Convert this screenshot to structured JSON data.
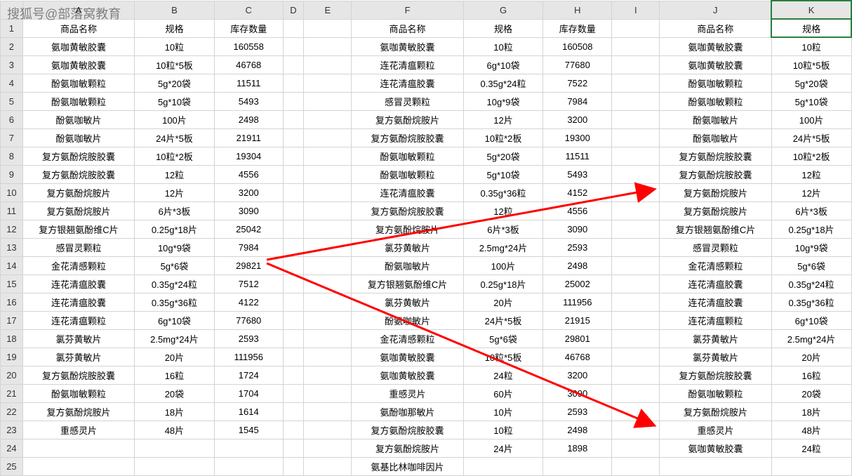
{
  "watermark": "搜狐号@部落窝教育",
  "colLetters": [
    "A",
    "B",
    "C",
    "D",
    "E",
    "F",
    "G",
    "H",
    "I",
    "J",
    "K"
  ],
  "rowNums": [
    "1",
    "2",
    "3",
    "4",
    "5",
    "6",
    "7",
    "8",
    "9",
    "10",
    "11",
    "12",
    "13",
    "14",
    "15",
    "16",
    "17",
    "18",
    "19",
    "20",
    "21",
    "22",
    "23",
    "24",
    "25"
  ],
  "headers": [
    "商品名称",
    "规格",
    "库存数量"
  ],
  "headers2": [
    "商品名称",
    "规格"
  ],
  "table1": [
    {
      "n": "氨咖黄敏胶囊",
      "s": "10粒",
      "q": "160558"
    },
    {
      "n": "氨咖黄敏胶囊",
      "s": "10粒*5板",
      "q": "46768"
    },
    {
      "n": "酚氨咖敏颗粒",
      "s": "5g*20袋",
      "q": "11511"
    },
    {
      "n": "酚氨咖敏颗粒",
      "s": "5g*10袋",
      "q": "5493"
    },
    {
      "n": "酚氨咖敏片",
      "s": "100片",
      "q": "2498"
    },
    {
      "n": "酚氨咖敏片",
      "s": "24片*5板",
      "q": "21911"
    },
    {
      "n": "复方氨酚烷胺胶囊",
      "s": "10粒*2板",
      "q": "19304"
    },
    {
      "n": "复方氨酚烷胺胶囊",
      "s": "12粒",
      "q": "4556"
    },
    {
      "n": "复方氨酚烷胺片",
      "s": "12片",
      "q": "3200"
    },
    {
      "n": "复方氨酚烷胺片",
      "s": "6片*3板",
      "q": "3090"
    },
    {
      "n": "复方银翘氨酚维C片",
      "s": "0.25g*18片",
      "q": "25042"
    },
    {
      "n": "感冒灵颗粒",
      "s": "10g*9袋",
      "q": "7984"
    },
    {
      "n": "金花清感颗粒",
      "s": "5g*6袋",
      "q": "29821"
    },
    {
      "n": "连花清瘟胶囊",
      "s": "0.35g*24粒",
      "q": "7512"
    },
    {
      "n": "连花清瘟胶囊",
      "s": "0.35g*36粒",
      "q": "4122"
    },
    {
      "n": "连花清瘟颗粒",
      "s": "6g*10袋",
      "q": "77680"
    },
    {
      "n": "氯芬黄敏片",
      "s": "2.5mg*24片",
      "q": "2593"
    },
    {
      "n": "氯芬黄敏片",
      "s": "20片",
      "q": "111956"
    },
    {
      "n": "复方氨酚烷胺胶囊",
      "s": "16粒",
      "q": "1724"
    },
    {
      "n": "酚氨咖敏颗粒",
      "s": "20袋",
      "q": "1704"
    },
    {
      "n": "复方氨酚烷胺片",
      "s": "18片",
      "q": "1614"
    },
    {
      "n": "重感灵片",
      "s": "48片",
      "q": "1545"
    },
    {
      "n": "",
      "s": "",
      "q": ""
    },
    {
      "n": "",
      "s": "",
      "q": ""
    }
  ],
  "table2": [
    {
      "n": "氨咖黄敏胶囊",
      "s": "10粒",
      "q": "160508"
    },
    {
      "n": "连花清瘟颗粒",
      "s": "6g*10袋",
      "q": "77680"
    },
    {
      "n": "连花清瘟胶囊",
      "s": "0.35g*24粒",
      "q": "7522"
    },
    {
      "n": "感冒灵颗粒",
      "s": "10g*9袋",
      "q": "7984"
    },
    {
      "n": "复方氨酚烷胺片",
      "s": "12片",
      "q": "3200"
    },
    {
      "n": "复方氨酚烷胺胶囊",
      "s": "10粒*2板",
      "q": "19300"
    },
    {
      "n": "酚氨咖敏颗粒",
      "s": "5g*20袋",
      "q": "11511"
    },
    {
      "n": "酚氨咖敏颗粒",
      "s": "5g*10袋",
      "q": "5493"
    },
    {
      "n": "连花清瘟胶囊",
      "s": "0.35g*36粒",
      "q": "4152"
    },
    {
      "n": "复方氨酚烷胺胶囊",
      "s": "12粒",
      "q": "4556"
    },
    {
      "n": "复方氨酚烷胺片",
      "s": "6片*3板",
      "q": "3090"
    },
    {
      "n": "氯芬黄敏片",
      "s": "2.5mg*24片",
      "q": "2593"
    },
    {
      "n": "酚氨咖敏片",
      "s": "100片",
      "q": "2498"
    },
    {
      "n": "复方银翘氨酚维C片",
      "s": "0.25g*18片",
      "q": "25002"
    },
    {
      "n": "氯芬黄敏片",
      "s": "20片",
      "q": "111956"
    },
    {
      "n": "酚氨咖敏片",
      "s": "24片*5板",
      "q": "21915"
    },
    {
      "n": "金花清感颗粒",
      "s": "5g*6袋",
      "q": "29801"
    },
    {
      "n": "氨咖黄敏胶囊",
      "s": "10粒*5板",
      "q": "46768"
    },
    {
      "n": "氨咖黄敏胶囊",
      "s": "24粒",
      "q": "3200"
    },
    {
      "n": "重感灵片",
      "s": "60片",
      "q": "3090"
    },
    {
      "n": "氨酚咖那敏片",
      "s": "10片",
      "q": "2593"
    },
    {
      "n": "复方氨酚烷胺胶囊",
      "s": "10粒",
      "q": "2498"
    },
    {
      "n": "复方氨酚烷胺片",
      "s": "24片",
      "q": "1898"
    },
    {
      "n": "氨基比林咖啡因片",
      "s": "",
      "q": ""
    }
  ],
  "table3": [
    {
      "n": "氨咖黄敏胶囊",
      "s": "10粒"
    },
    {
      "n": "氨咖黄敏胶囊",
      "s": "10粒*5板"
    },
    {
      "n": "酚氨咖敏颗粒",
      "s": "5g*20袋"
    },
    {
      "n": "酚氨咖敏颗粒",
      "s": "5g*10袋"
    },
    {
      "n": "酚氨咖敏片",
      "s": "100片"
    },
    {
      "n": "酚氨咖敏片",
      "s": "24片*5板"
    },
    {
      "n": "复方氨酚烷胺胶囊",
      "s": "10粒*2板"
    },
    {
      "n": "复方氨酚烷胺胶囊",
      "s": "12粒"
    },
    {
      "n": "复方氨酚烷胺片",
      "s": "12片"
    },
    {
      "n": "复方氨酚烷胺片",
      "s": "6片*3板"
    },
    {
      "n": "复方银翘氨酚维C片",
      "s": "0.25g*18片"
    },
    {
      "n": "感冒灵颗粒",
      "s": "10g*9袋"
    },
    {
      "n": "金花清感颗粒",
      "s": "5g*6袋"
    },
    {
      "n": "连花清瘟胶囊",
      "s": "0.35g*24粒"
    },
    {
      "n": "连花清瘟胶囊",
      "s": "0.35g*36粒"
    },
    {
      "n": "连花清瘟颗粒",
      "s": "6g*10袋"
    },
    {
      "n": "氯芬黄敏片",
      "s": "2.5mg*24片"
    },
    {
      "n": "氯芬黄敏片",
      "s": "20片"
    },
    {
      "n": "复方氨酚烷胺胶囊",
      "s": "16粒"
    },
    {
      "n": "酚氨咖敏颗粒",
      "s": "20袋"
    },
    {
      "n": "复方氨酚烷胺片",
      "s": "18片"
    },
    {
      "n": "重感灵片",
      "s": "48片"
    },
    {
      "n": "氨咖黄敏胶囊",
      "s": "24粒"
    },
    {
      "n": "",
      "s": ""
    }
  ]
}
